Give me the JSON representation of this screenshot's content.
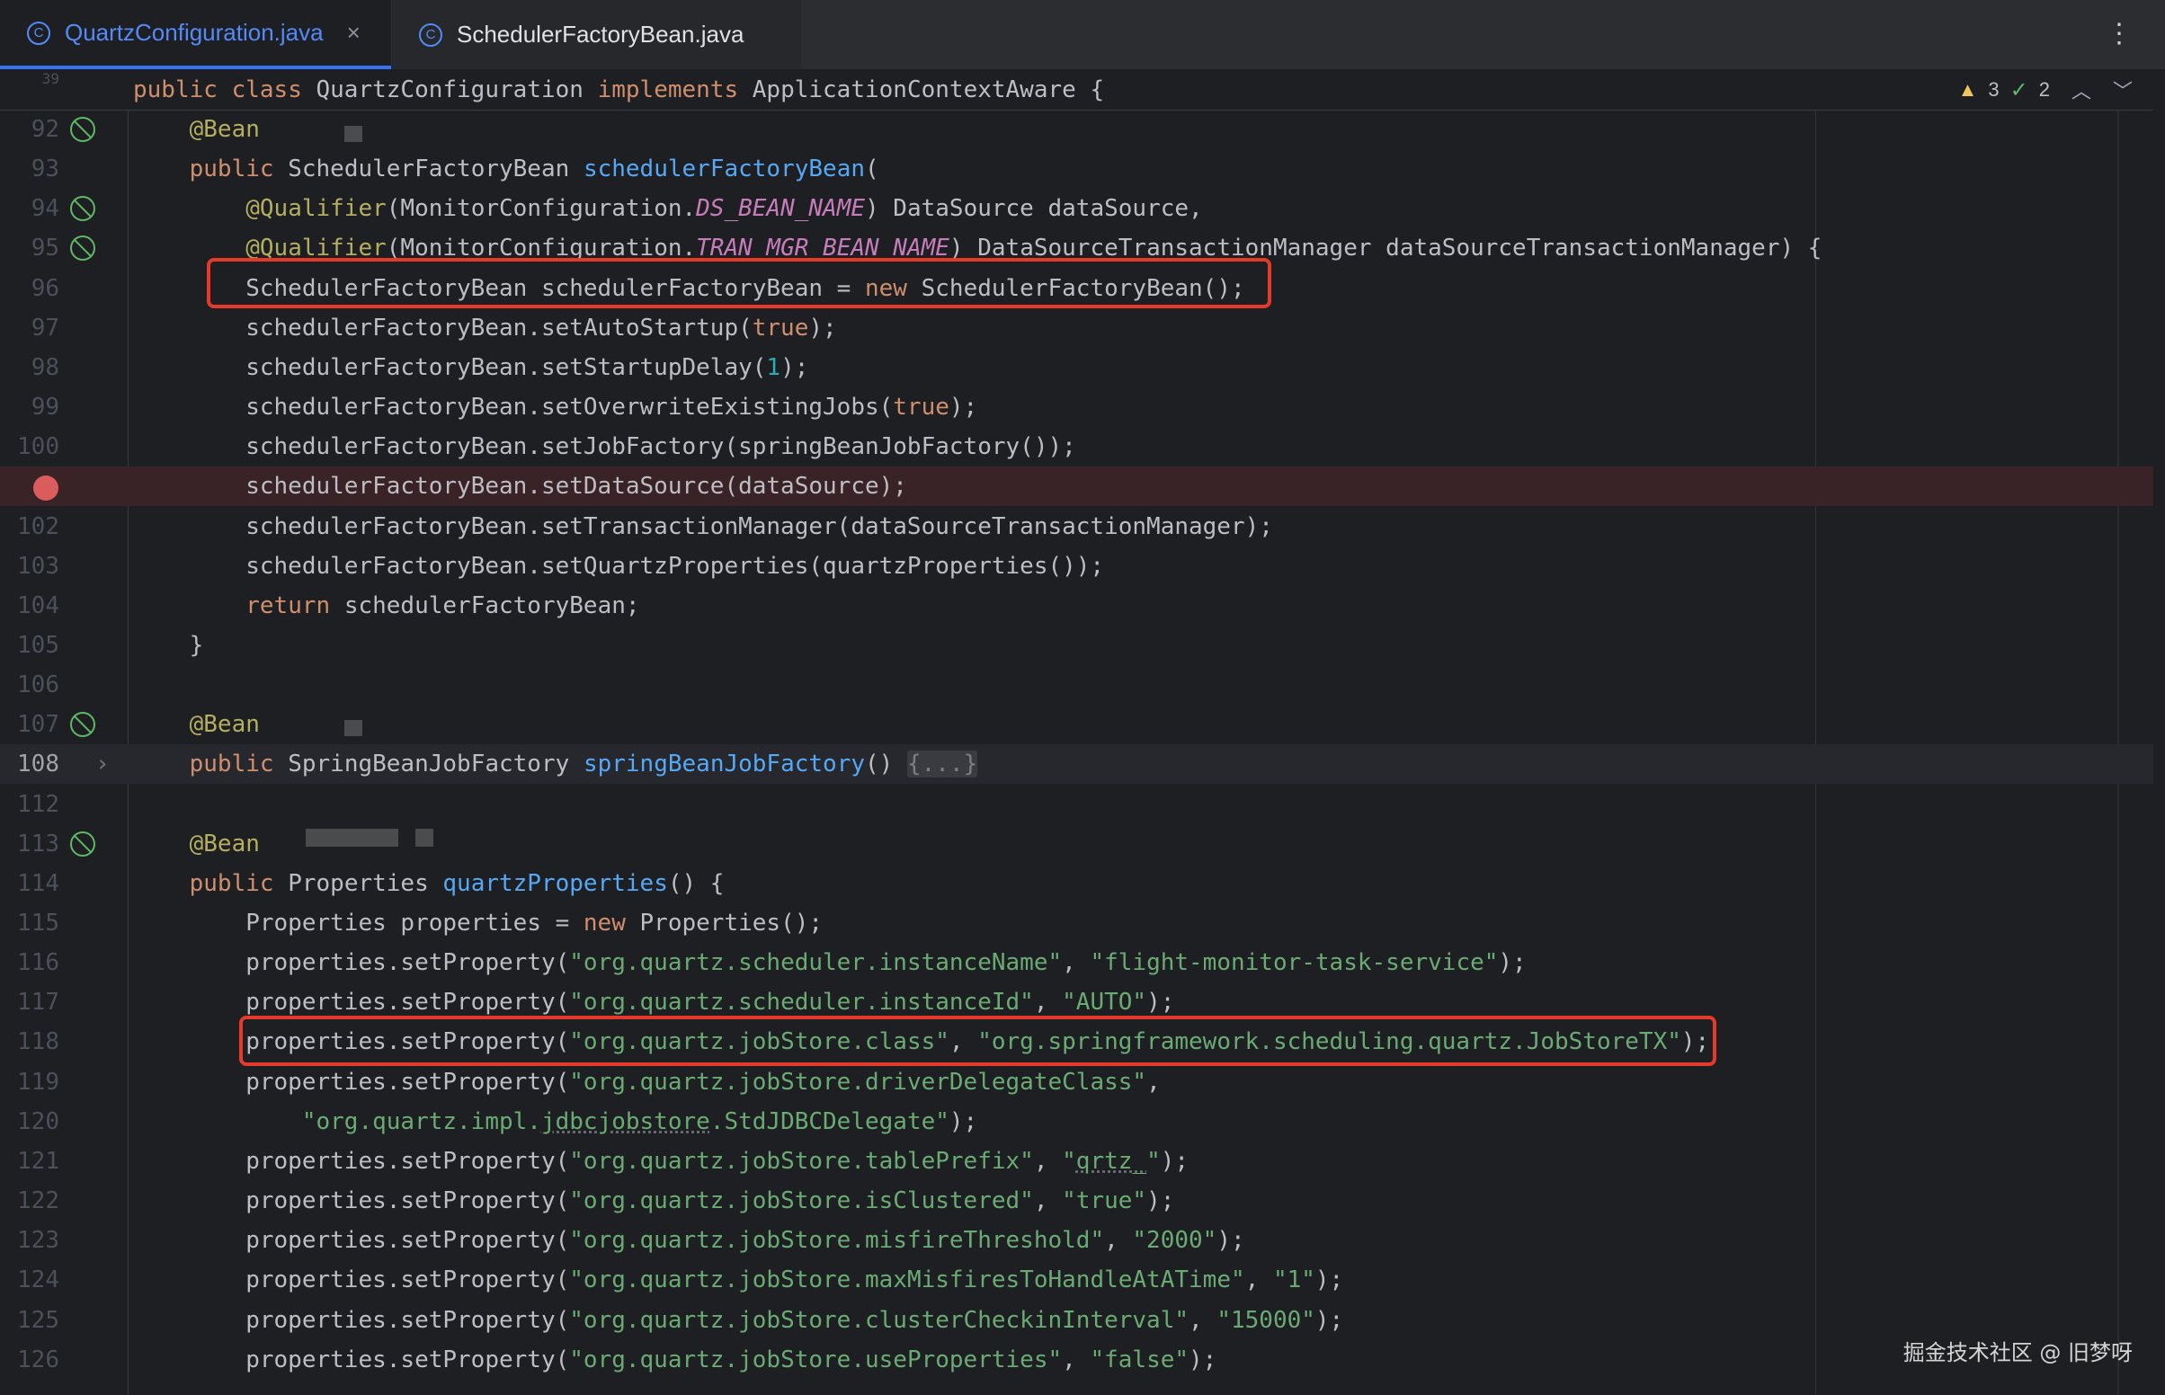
{
  "tabs": [
    {
      "label": "QuartzConfiguration.java",
      "active": true,
      "icon": "java-class-icon",
      "close": "×"
    },
    {
      "label": "SchedulerFactoryBean.java",
      "active": false,
      "icon": "java-class-icon"
    }
  ],
  "tab_menu": "⋮",
  "inspections": {
    "warnings": "3",
    "ok": "2",
    "prev": "︿",
    "next": "﹀"
  },
  "sticky_line": {
    "num": "39",
    "tokens": [
      [
        "kw",
        "public "
      ],
      [
        "kw",
        "class "
      ],
      [
        "",
        "QuartzConfiguration "
      ],
      [
        "kw",
        "implements "
      ],
      [
        "",
        "ApplicationContextAware {"
      ]
    ]
  },
  "lines": [
    {
      "num": "92",
      "gutter": "bean-icon",
      "tokens": [
        [
          "",
          "    "
        ],
        [
          "ann",
          "@Bean"
        ]
      ]
    },
    {
      "num": "93",
      "tokens": [
        [
          "",
          "    "
        ],
        [
          "kw",
          "public "
        ],
        [
          "",
          "SchedulerFactoryBean "
        ],
        [
          "fn",
          "schedulerFactoryBean"
        ],
        [
          "",
          "("
        ]
      ]
    },
    {
      "num": "94",
      "gutter": "bean-icon",
      "tokens": [
        [
          "",
          "        "
        ],
        [
          "ann",
          "@Qualifier"
        ],
        [
          "",
          "(MonitorConfiguration."
        ],
        [
          "cst",
          "DS_BEAN_NAME"
        ],
        [
          "",
          ") DataSource dataSource,"
        ]
      ]
    },
    {
      "num": "95",
      "gutter": "bean-icon",
      "tokens": [
        [
          "",
          "        "
        ],
        [
          "ann",
          "@Qualifier"
        ],
        [
          "",
          "(MonitorConfiguration."
        ],
        [
          "cst",
          "TRAN_MGR_BEAN_NAME"
        ],
        [
          "",
          ") DataSourceTransactionManager dataSourceTransactionManager) {"
        ]
      ]
    },
    {
      "num": "96",
      "tokens": [
        [
          "",
          "        SchedulerFactoryBean schedulerFactoryBean = "
        ],
        [
          "kw",
          "new "
        ],
        [
          "",
          "SchedulerFactoryBean();"
        ]
      ]
    },
    {
      "num": "97",
      "tokens": [
        [
          "",
          "        schedulerFactoryBean.setAutoStartup("
        ],
        [
          "kw",
          "true"
        ],
        [
          "",
          ");"
        ]
      ]
    },
    {
      "num": "98",
      "tokens": [
        [
          "",
          "        schedulerFactoryBean.setStartupDelay("
        ],
        [
          "num",
          "1"
        ],
        [
          "",
          ");"
        ]
      ]
    },
    {
      "num": "99",
      "tokens": [
        [
          "",
          "        schedulerFactoryBean.setOverwriteExistingJobs("
        ],
        [
          "kw",
          "true"
        ],
        [
          "",
          ");"
        ]
      ]
    },
    {
      "num": "100",
      "tokens": [
        [
          "",
          "        schedulerFactoryBean.setJobFactory(springBeanJobFactory());"
        ]
      ]
    },
    {
      "num": "",
      "breakpoint": true,
      "tokens": [
        [
          "",
          "        schedulerFactoryBean.setDataSource(dataSource);"
        ]
      ]
    },
    {
      "num": "102",
      "tokens": [
        [
          "",
          "        schedulerFactoryBean.setTransactionManager(dataSourceTransactionManager);"
        ]
      ]
    },
    {
      "num": "103",
      "tokens": [
        [
          "",
          "        schedulerFactoryBean.setQuartzProperties(quartzProperties());"
        ]
      ]
    },
    {
      "num": "104",
      "tokens": [
        [
          "",
          "        "
        ],
        [
          "kw",
          "return "
        ],
        [
          "",
          "schedulerFactoryBean;"
        ]
      ]
    },
    {
      "num": "105",
      "tokens": [
        [
          "",
          "    }"
        ]
      ]
    },
    {
      "num": "106",
      "tokens": []
    },
    {
      "num": "107",
      "gutter": "bean-icon",
      "tokens": [
        [
          "",
          "    "
        ],
        [
          "ann",
          "@Bean"
        ]
      ]
    },
    {
      "num": "108",
      "current": true,
      "fold_arrow": "›",
      "tokens": [
        [
          "",
          "    "
        ],
        [
          "kw",
          "public "
        ],
        [
          "",
          "SpringBeanJobFactory "
        ],
        [
          "fn",
          "springBeanJobFactory"
        ],
        [
          "",
          "() "
        ],
        [
          "fold",
          "{...}"
        ]
      ]
    },
    {
      "num": "112",
      "tokens": []
    },
    {
      "num": "113",
      "gutter": "bean-icon",
      "tokens": [
        [
          "",
          "    "
        ],
        [
          "ann",
          "@Bean"
        ]
      ]
    },
    {
      "num": "114",
      "tokens": [
        [
          "",
          "    "
        ],
        [
          "kw",
          "public "
        ],
        [
          "",
          "Properties "
        ],
        [
          "fn",
          "quartzProperties"
        ],
        [
          "",
          "() {"
        ]
      ]
    },
    {
      "num": "115",
      "tokens": [
        [
          "",
          "        Properties properties = "
        ],
        [
          "kw",
          "new "
        ],
        [
          "",
          "Properties();"
        ]
      ]
    },
    {
      "num": "116",
      "tokens": [
        [
          "",
          "        properties.setProperty("
        ],
        [
          "str",
          "\"org.quartz.scheduler.instanceName\""
        ],
        [
          "",
          ", "
        ],
        [
          "str",
          "\"flight-monitor-task-service\""
        ],
        [
          "",
          ");"
        ]
      ]
    },
    {
      "num": "117",
      "tokens": [
        [
          "",
          "        properties.setProperty("
        ],
        [
          "str",
          "\"org.quartz.scheduler.instanceId\""
        ],
        [
          "",
          ", "
        ],
        [
          "str",
          "\"AUTO\""
        ],
        [
          "",
          ");"
        ]
      ]
    },
    {
      "num": "118",
      "tokens": [
        [
          "",
          "        properties.setProperty("
        ],
        [
          "str",
          "\"org.quartz.jobStore.class\""
        ],
        [
          "",
          ", "
        ],
        [
          "str",
          "\"org.springframework.scheduling.quartz.JobStoreTX\""
        ],
        [
          "",
          ");"
        ]
      ]
    },
    {
      "num": "119",
      "tokens": [
        [
          "",
          "        properties.setProperty("
        ],
        [
          "str",
          "\"org.quartz.jobStore.driverDelegateClass\""
        ],
        [
          "",
          ","
        ]
      ]
    },
    {
      "num": "120",
      "tokens": [
        [
          "",
          "            "
        ],
        [
          "str",
          "\"org.quartz.impl."
        ],
        [
          "str squig",
          "jdbcjobstore"
        ],
        [
          "str",
          ".StdJDBCDelegate\""
        ],
        [
          "",
          ");"
        ]
      ]
    },
    {
      "num": "121",
      "tokens": [
        [
          "",
          "        properties.setProperty("
        ],
        [
          "str",
          "\"org.quartz.jobStore.tablePrefix\""
        ],
        [
          "",
          ", "
        ],
        [
          "str",
          "\""
        ],
        [
          "str squig",
          "qrtz_"
        ],
        [
          "str",
          "\""
        ],
        [
          "",
          ");"
        ]
      ]
    },
    {
      "num": "122",
      "tokens": [
        [
          "",
          "        properties.setProperty("
        ],
        [
          "str",
          "\"org.quartz.jobStore.isClustered\""
        ],
        [
          "",
          ", "
        ],
        [
          "str",
          "\"true\""
        ],
        [
          "",
          ");"
        ]
      ]
    },
    {
      "num": "123",
      "tokens": [
        [
          "",
          "        properties.setProperty("
        ],
        [
          "str",
          "\"org.quartz.jobStore.misfireThreshold\""
        ],
        [
          "",
          ", "
        ],
        [
          "str",
          "\"2000\""
        ],
        [
          "",
          ");"
        ]
      ]
    },
    {
      "num": "124",
      "tokens": [
        [
          "",
          "        properties.setProperty("
        ],
        [
          "str",
          "\"org.quartz.jobStore.maxMisfiresToHandleAtATime\""
        ],
        [
          "",
          ", "
        ],
        [
          "str",
          "\"1\""
        ],
        [
          "",
          ");"
        ]
      ]
    },
    {
      "num": "125",
      "tokens": [
        [
          "",
          "        properties.setProperty("
        ],
        [
          "str",
          "\"org.quartz.jobStore.clusterCheckinInterval\""
        ],
        [
          "",
          ", "
        ],
        [
          "str",
          "\"15000\""
        ],
        [
          "",
          ");"
        ]
      ]
    },
    {
      "num": "126",
      "tokens": [
        [
          "",
          "        properties.setProperty("
        ],
        [
          "str",
          "\"org.quartz.jobStore.useProperties\""
        ],
        [
          "",
          ", "
        ],
        [
          "str",
          "\"false\""
        ],
        [
          "",
          ");"
        ]
      ]
    }
  ],
  "highlighted_lines": [
    "96",
    "118"
  ],
  "watermark": "掘金技术社区 @ 旧梦呀",
  "colors": {
    "keyword": "#cf8e6d",
    "annotation": "#b3ae60",
    "method": "#56a8f5",
    "string": "#6aab73",
    "number": "#2aacb8",
    "constant": "#c77dbb",
    "highlight_box": "#e53a2a",
    "breakpoint": "#db5c5c"
  }
}
